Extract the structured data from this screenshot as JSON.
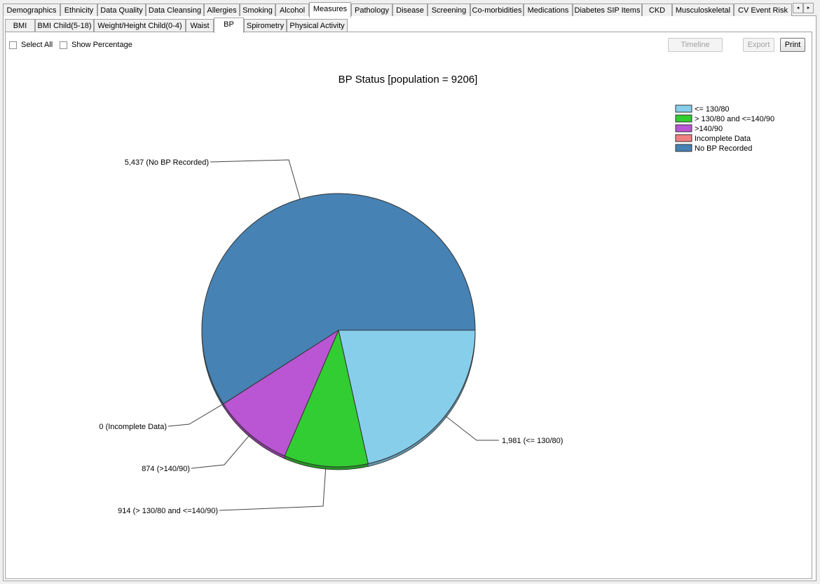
{
  "main_tabs": [
    {
      "label": "Demographics",
      "active": false
    },
    {
      "label": "Ethnicity",
      "active": false
    },
    {
      "label": "Data Quality",
      "active": false
    },
    {
      "label": "Data Cleansing",
      "active": false
    },
    {
      "label": "Allergies",
      "active": false
    },
    {
      "label": "Smoking",
      "active": false
    },
    {
      "label": "Alcohol",
      "active": false
    },
    {
      "label": "Measures",
      "active": true
    },
    {
      "label": "Pathology",
      "active": false
    },
    {
      "label": "Disease",
      "active": false
    },
    {
      "label": "Screening",
      "active": false
    },
    {
      "label": "Co-morbidities",
      "active": false
    },
    {
      "label": "Medications",
      "active": false
    },
    {
      "label": "Diabetes SIP Items",
      "active": false
    },
    {
      "label": "CKD",
      "active": false
    },
    {
      "label": "Musculoskeletal",
      "active": false
    },
    {
      "label": "CV Event Risk",
      "active": false
    }
  ],
  "scroll": {
    "left_icon": "◂",
    "right_icon": "▸"
  },
  "sub_tabs": [
    {
      "label": "BMI",
      "active": false
    },
    {
      "label": "BMI Child(5-18)",
      "active": false
    },
    {
      "label": "Weight/Height Child(0-4)",
      "active": false
    },
    {
      "label": "Waist",
      "active": false
    },
    {
      "label": "BP",
      "active": true
    },
    {
      "label": "Spirometry",
      "active": false
    },
    {
      "label": "Physical Activity",
      "active": false
    }
  ],
  "options": {
    "select_all": {
      "label": "Select All",
      "checked": false
    },
    "show_percentage": {
      "label": "Show Percentage",
      "checked": false
    }
  },
  "buttons": {
    "timeline": "Timeline",
    "export": "Export",
    "print": "Print"
  },
  "chart_data": {
    "type": "pie",
    "title": "BP Status [population = 9206]",
    "legend_position": "top-right",
    "slices": [
      {
        "name": "<= 130/80",
        "value": 1981,
        "label": "1,981 (<= 130/80)",
        "color": "#87ceeb"
      },
      {
        "name": "> 130/80 and <=140/90",
        "value": 914,
        "label": "914 (> 130/80 and <=140/90)",
        "color": "#32cd32"
      },
      {
        "name": ">140/90",
        "value": 874,
        "label": "874 (>140/90)",
        "color": "#ba55d3"
      },
      {
        "name": "Incomplete Data",
        "value": 0,
        "label": "0 (Incomplete Data)",
        "color": "#f08080"
      },
      {
        "name": "No BP Recorded",
        "value": 5437,
        "label": "5,437 (No BP Recorded)",
        "color": "#4682b4"
      }
    ]
  }
}
